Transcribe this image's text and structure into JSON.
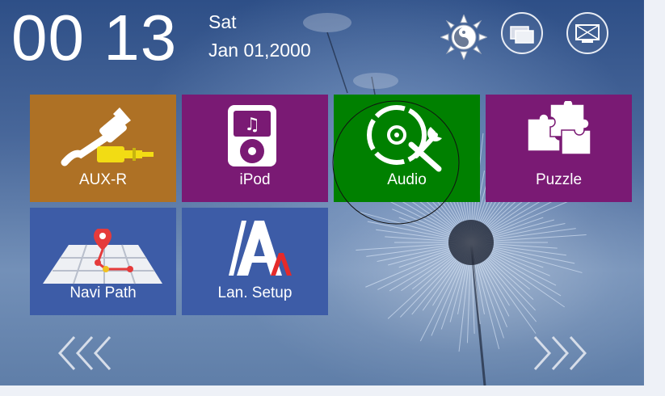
{
  "status": {
    "time_hours": "00",
    "time_minutes": "13",
    "day": "Sat",
    "date": "Jan 01,2000"
  },
  "toolbar": {
    "icons": [
      "brightness-icon",
      "window-switch-icon",
      "screen-off-icon"
    ]
  },
  "tiles": [
    {
      "label": "AUX-R",
      "color": "#ae7125",
      "icon": "aux-cable-icon"
    },
    {
      "label": "iPod",
      "color": "#7a1a74",
      "icon": "ipod-icon"
    },
    {
      "label": "Audio",
      "color": "#008000",
      "icon": "audio-settings-icon"
    },
    {
      "label": "Puzzle",
      "color": "#7a1a74",
      "icon": "puzzle-icon"
    },
    {
      "label": "Navi Path",
      "color": "#3d5ca7",
      "icon": "map-pin-icon"
    },
    {
      "label": "Lan. Setup",
      "color": "#3d5ca7",
      "icon": "language-icon"
    }
  ],
  "navigation": {
    "prev_icon": "triple-chevron-left-icon",
    "next_icon": "triple-chevron-right-icon"
  }
}
